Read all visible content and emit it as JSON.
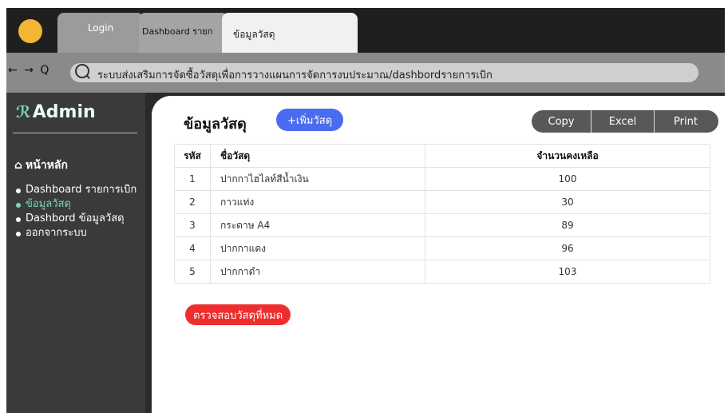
{
  "tabs": {
    "login": "Login",
    "dashboard": "Dashboard รายก",
    "active": "ข้อมูลวัสดุ"
  },
  "nav": {
    "back": "←",
    "forward": "→",
    "refresh": "Q",
    "url": "ระบบส่งเสริมการจัดซื้อวัสดุเพื่อการวางแผนการจัดการงบประมาณ/dashbordรายการเบิก"
  },
  "sidebar": {
    "brand": "Admin",
    "home": "หน้าหลัก",
    "items": [
      {
        "label": "Dashboard รายการเบิก"
      },
      {
        "label": "ข้อมูลวัสดุ"
      },
      {
        "label": "Dashbord ข้อมูลวัสดุ"
      },
      {
        "label": "ออกจากระบบ"
      }
    ]
  },
  "main": {
    "title": "ข้อมูลวัสดุ",
    "add_button": "+เพิ่มวัสดุ",
    "export": {
      "copy": "Copy",
      "excel": "Excel",
      "print": "Print"
    },
    "table": {
      "headers": [
        "รหัส",
        "ชื่อวัสดุ",
        "จำนวนคงเหลือ"
      ],
      "rows": [
        [
          "1",
          "ปากกาไฮไลท์สีน้ำเงิน",
          "100"
        ],
        [
          "2",
          "กาวแท่ง",
          "30"
        ],
        [
          "3",
          "กระดาษ A4",
          "89"
        ],
        [
          "4",
          "ปากกาแดง",
          "96"
        ],
        [
          "5",
          "ปากกาดำ",
          "103"
        ]
      ]
    },
    "check_button": "ตรวจสอบวัสดุที่หมด"
  },
  "colors": {
    "accent": "#4a6cf0",
    "danger": "#ee2e2e",
    "active_menu": "#7ed6b4",
    "sidebar": "#3a3a3a"
  }
}
